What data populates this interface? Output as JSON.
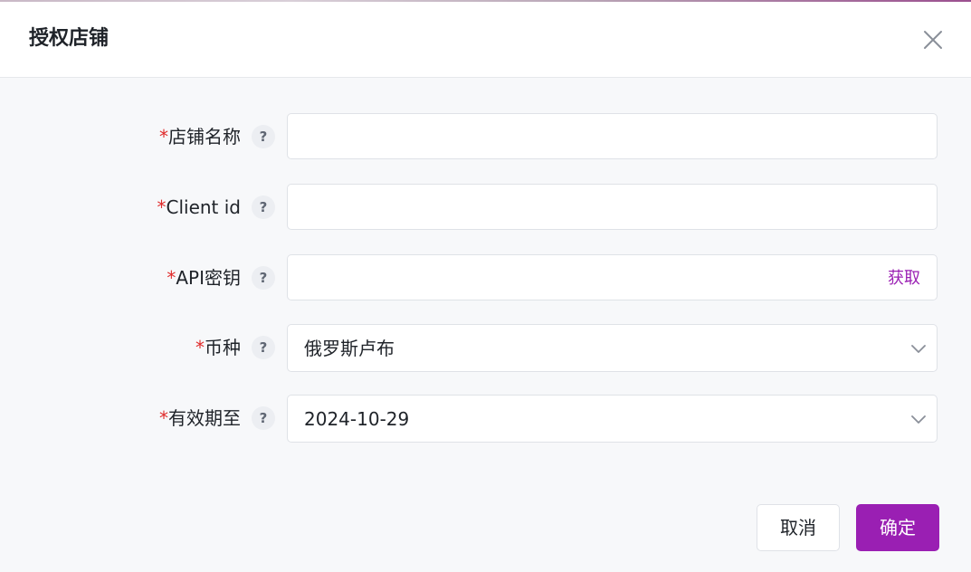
{
  "dialog": {
    "title": "授权店铺"
  },
  "form": {
    "required_mark": "*",
    "help_glyph": "?",
    "fields": [
      {
        "label": "店铺名称",
        "value": "",
        "placeholder": ""
      },
      {
        "label": "Client id",
        "value": "",
        "placeholder": ""
      },
      {
        "label": "API密钥",
        "value": "",
        "placeholder": "",
        "action_label": "获取"
      },
      {
        "label": "币种",
        "value": "俄罗斯卢布"
      },
      {
        "label": "有效期至",
        "value": "2024-10-29"
      }
    ]
  },
  "footer": {
    "cancel_label": "取消",
    "confirm_label": "确定"
  },
  "colors": {
    "accent": "#9a1fb3",
    "required": "#e02b2b",
    "background": "#f7f8fa"
  },
  "icons": {
    "close": "close-icon",
    "help": "question-icon",
    "dropdown": "chevron-down-icon"
  }
}
